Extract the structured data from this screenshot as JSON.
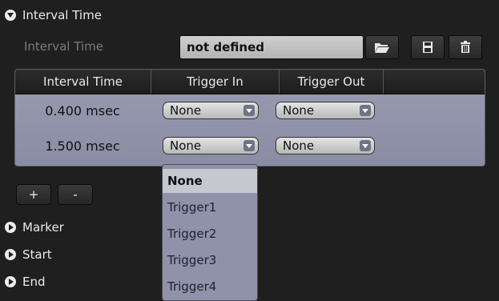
{
  "interval_section": {
    "title": "Interval Time"
  },
  "interval_row": {
    "label": "Interval Time",
    "name_value": "not defined",
    "open_icon": "folder-open-icon",
    "save_icon": "save-icon",
    "delete_icon": "trash-icon"
  },
  "table": {
    "headers": [
      "Interval Time",
      "Trigger In",
      "Trigger Out"
    ],
    "rows": [
      {
        "time": "0.400 msec",
        "trigger_in": "None",
        "trigger_out": "None"
      },
      {
        "time": "1.500 msec",
        "trigger_in": "None",
        "trigger_out": "None"
      }
    ]
  },
  "buttons": {
    "add": "+",
    "remove": "-"
  },
  "sections": [
    "Marker",
    "Start",
    "End"
  ],
  "dropdown": {
    "options": [
      "None",
      "Trigger1",
      "Trigger2",
      "Trigger3",
      "Trigger4"
    ],
    "selected": "None"
  },
  "colors": {
    "table_bg": "#9a9cb2",
    "dropdown_bg": "#8f92a8",
    "field_bg": "#c4c4c4"
  }
}
